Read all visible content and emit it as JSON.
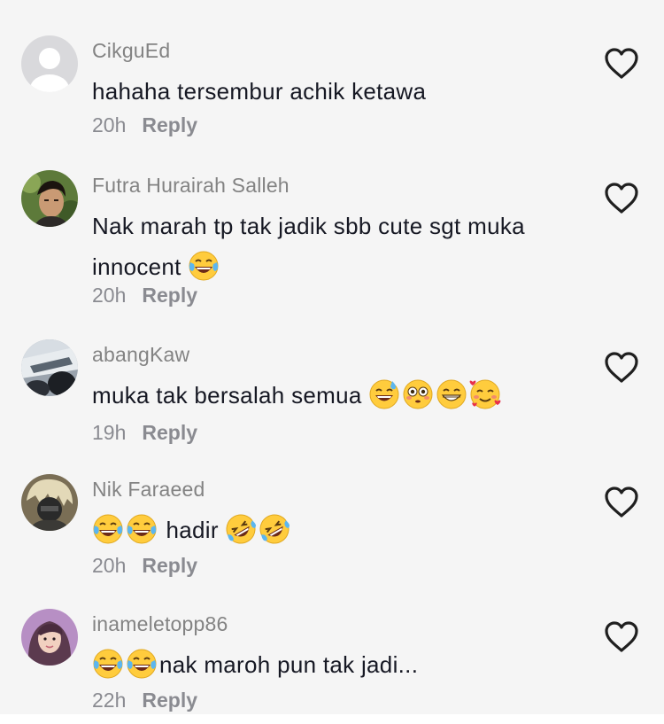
{
  "comments": [
    {
      "username": "CikguEd",
      "segments": [
        {
          "type": "text",
          "value": "hahaha tersembur achik ketawa"
        }
      ],
      "time": "20h",
      "reply_label": "Reply",
      "avatar": "default-avatar"
    },
    {
      "username": "Futra Hurairah Salleh",
      "segments": [
        {
          "type": "text",
          "value": "Nak marah tp tak jadik sbb cute sgt muka innocent "
        },
        {
          "type": "emoji",
          "value": "face-with-tears-of-joy"
        }
      ],
      "time": "20h",
      "reply_label": "Reply",
      "avatar": "photo-avatar"
    },
    {
      "username": "abangKaw",
      "segments": [
        {
          "type": "text",
          "value": "muka tak bersalah semua "
        },
        {
          "type": "emoji",
          "value": "grinning-sweat"
        },
        {
          "type": "emoji",
          "value": "flushed-face"
        },
        {
          "type": "emoji",
          "value": "beaming-face"
        },
        {
          "type": "emoji",
          "value": "smiling-face-with-hearts"
        }
      ],
      "time": "19h",
      "reply_label": "Reply",
      "avatar": "photo-avatar"
    },
    {
      "username": "Nik Faraeed",
      "segments": [
        {
          "type": "emoji",
          "value": "face-with-tears-of-joy"
        },
        {
          "type": "emoji",
          "value": "face-with-tears-of-joy"
        },
        {
          "type": "text",
          "value": " hadir "
        },
        {
          "type": "emoji",
          "value": "rolling-on-floor-laughing"
        },
        {
          "type": "emoji",
          "value": "rolling-on-floor-laughing"
        }
      ],
      "time": "20h",
      "reply_label": "Reply",
      "avatar": "photo-avatar"
    },
    {
      "username": "inameletopp86",
      "segments": [
        {
          "type": "emoji",
          "value": "face-with-tears-of-joy"
        },
        {
          "type": "emoji",
          "value": "face-with-tears-of-joy"
        },
        {
          "type": "text",
          "value": "nak maroh pun tak jadi..."
        }
      ],
      "time": "22h",
      "reply_label": "Reply",
      "avatar": "photo-avatar"
    }
  ],
  "like_icon": "heart-outline-icon",
  "colors": {
    "background": "#f5f5f5",
    "username": "#838383",
    "text": "#161823",
    "meta": "#8a8b91",
    "heart": "#1f1f1f"
  }
}
